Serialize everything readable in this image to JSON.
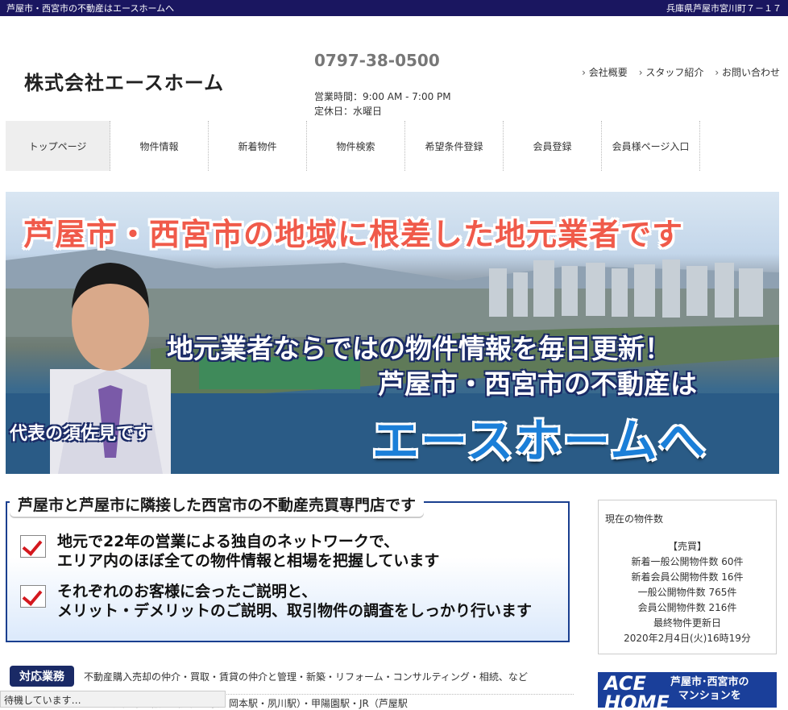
{
  "topbar": {
    "left": "芦屋市・西宮市の不動産はエースホームへ",
    "right": "兵庫県芦屋市宮川町７－１７"
  },
  "header": {
    "company": "株式会社エースホーム",
    "phone": "0797-38-0500",
    "hours": "営業時間：9:00 AM - 7:00 PM",
    "closed": "定休日：水曜日",
    "links": [
      "会社概要",
      "スタッフ紹介",
      "お問い合わせ"
    ]
  },
  "nav": [
    "トップページ",
    "物件情報",
    "新着物件",
    "物件検索",
    "希望条件登録",
    "会員登録",
    "会員様ページ入口"
  ],
  "hero": {
    "title": "芦屋市・西宮市の地域に根差した地元業者です",
    "msg1": "地元業者ならではの物件情報を毎日更新！",
    "msg2": "芦屋市・西宮市の不動産は",
    "brand": "エースホームへ",
    "rep": "代表の須佐見です"
  },
  "promo": {
    "heading": "芦屋市と芦屋市に隣接した西宮市の不動産売買専門店です",
    "item1": [
      "地元で22年の営業による独自のネットワークで、",
      "エリア内のほぼ全ての物件情報と相場を把握しています"
    ],
    "item2": [
      "それぞれのお客様に会ったご説明と、",
      "メリット・デメリットのご説明、取引物件の調査をしっかり行います"
    ]
  },
  "business": {
    "label": "対応業務",
    "text": "不動産購入売却の仲介・買取・賃貸の仲介と管理・新築・リフォーム・コンサルティング・相続、など",
    "area": "芦屋市　阪急（芦屋川駅・岡本駅・夙川駅）・甲陽園駅・JR（芦屋駅"
  },
  "side": {
    "title": "現在の物件数",
    "lines": [
      "【売買】",
      "新着一般公開物件数 60件",
      "新着会員公開物件数 16件",
      "一般公開物件数 765件",
      "会員公開物件数 216件",
      "最終物件更新日",
      "2020年2月4日(火)16時19分"
    ]
  },
  "banner": {
    "logo1": "ACE",
    "logo2": "HOME",
    "line1": "芦屋市･西宮市の",
    "line2": "マンションを"
  },
  "status": "待機しています…",
  "colors": {
    "topbar": "#1a1660",
    "hero_title": "#f05a4a",
    "brand": "#1b7fd8",
    "check": "#d4181e"
  }
}
